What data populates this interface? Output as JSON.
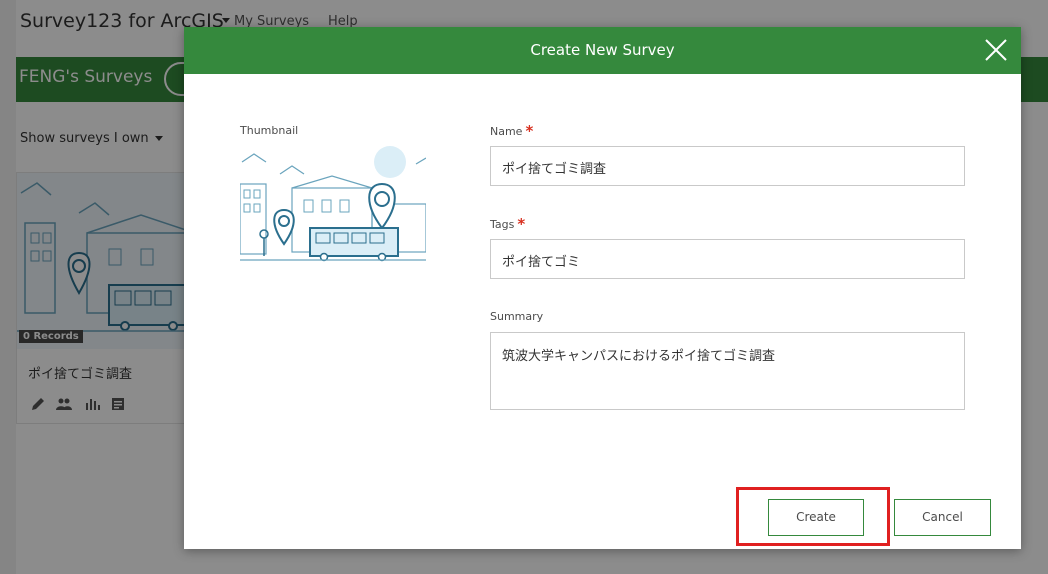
{
  "app": {
    "title": "Survey123 for ArcGIS",
    "nav": [
      "My Surveys",
      "Help"
    ],
    "banner_title": "FENG's Surveys",
    "filter_label": "Show surveys I own",
    "card": {
      "records_badge": "0 Records",
      "title": "ポイ捨てゴミ調査",
      "icons": [
        "edit-icon",
        "collaborate-icon",
        "analyze-icon",
        "data-icon"
      ]
    }
  },
  "modal": {
    "title": "Create New Survey",
    "thumbnail_label": "Thumbnail",
    "name_label": "Name",
    "name_value": "ポイ捨てゴミ調査",
    "tags_label": "Tags",
    "tags_value": "ポイ捨てゴミ",
    "summary_label": "Summary",
    "summary_value": "筑波大学キャンパスにおけるポイ捨てゴミ調査",
    "required_mark": "*",
    "create_label": "Create",
    "cancel_label": "Cancel"
  },
  "colors": {
    "brand_green": "#35893d",
    "required_red": "#d83020",
    "highlight_red": "#e02020"
  }
}
